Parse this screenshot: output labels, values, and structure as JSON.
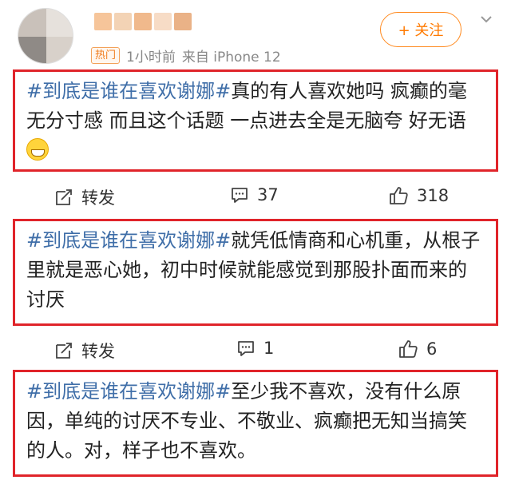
{
  "post": {
    "badge": "热门",
    "time": "1小时前",
    "source": "来自 iPhone 12",
    "follow_label": "+ 关注"
  },
  "comments": [
    {
      "tag": "#到底是谁在喜欢谢娜#",
      "text": "真的有人喜欢她吗 疯癫的毫无分寸感 而且这个话题 一点进去全是无脑夸 好无语",
      "emoji": "grinning-emoji",
      "actions": {
        "repost_label": "转发",
        "comments": "37",
        "likes": "318"
      }
    },
    {
      "tag": "#到底是谁在喜欢谢娜#",
      "text": "就凭低情商和心机重，从根子里就是恶心她，初中时候就能感觉到那股扑面而来的讨厌",
      "actions": {
        "repost_label": "转发",
        "comments": "1",
        "likes": "6"
      }
    },
    {
      "tag": "#到底是谁在喜欢谢娜#",
      "text": "至少我不喜欢，没有什么原因，单纯的讨厌不专业、不敬业、疯癫把无知当搞笑的人。对，样子也不喜欢。"
    }
  ],
  "icons": {
    "repost": "repost-icon",
    "comment": "comment-icon",
    "like": "thumbs-up-icon",
    "more": "chevron-down-icon"
  },
  "colors": {
    "accent": "#ff7a00",
    "hashtag": "#3f6ea8",
    "highlight_border": "#e0242a"
  }
}
